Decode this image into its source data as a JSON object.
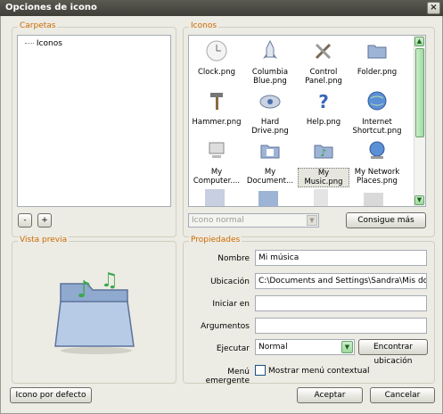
{
  "window": {
    "title": "Opciones de icono",
    "close_glyph": "×"
  },
  "folders": {
    "title": "Carpetas",
    "tree_item": "Iconos",
    "remove_label": "-",
    "add_label": "+"
  },
  "icons": {
    "title": "Iconos",
    "items": [
      {
        "label": "Clock.png",
        "icon": "clock-icon"
      },
      {
        "label": "Columbia Blue.png",
        "icon": "rocket-icon"
      },
      {
        "label": "Control Panel.png",
        "icon": "tools-icon"
      },
      {
        "label": "Folder.png",
        "icon": "folder-icon"
      },
      {
        "label": "Hammer.png",
        "icon": "hammer-icon"
      },
      {
        "label": "Hard Drive.png",
        "icon": "hard-drive-icon"
      },
      {
        "label": "Help.png",
        "icon": "help-icon"
      },
      {
        "label": "Internet Shortcut.png",
        "icon": "globe-icon"
      },
      {
        "label": "My Computer....",
        "icon": "computer-icon"
      },
      {
        "label": "My Document...",
        "icon": "documents-folder-icon"
      },
      {
        "label": "My Music.png",
        "icon": "music-folder-icon"
      },
      {
        "label": "My Network Places.png",
        "icon": "network-globe-icon"
      }
    ],
    "size_select": "Icono normal",
    "get_more_label": "Consigue más"
  },
  "preview": {
    "title": "Vista previa"
  },
  "properties": {
    "title": "Propiedades",
    "name_label": "Nombre",
    "name_value": "Mi música",
    "location_label": "Ubicación",
    "location_value": "C:\\Documents and Settings\\Sandra\\Mis documen",
    "start_in_label": "Iniciar en",
    "start_in_value": "",
    "args_label": "Argumentos",
    "args_value": "",
    "run_label": "Ejecutar",
    "run_value": "Normal",
    "find_location_label": "Encontrar ubicación",
    "popup_label": "Menú emergente",
    "show_context_label": "Mostrar menú contextual"
  },
  "footer": {
    "default_icon_label": "Icono por defecto",
    "accept_label": "Aceptar",
    "cancel_label": "Cancelar"
  },
  "colors": {
    "accent": "#cc6a00",
    "scroll_green": "#9fd99f"
  }
}
